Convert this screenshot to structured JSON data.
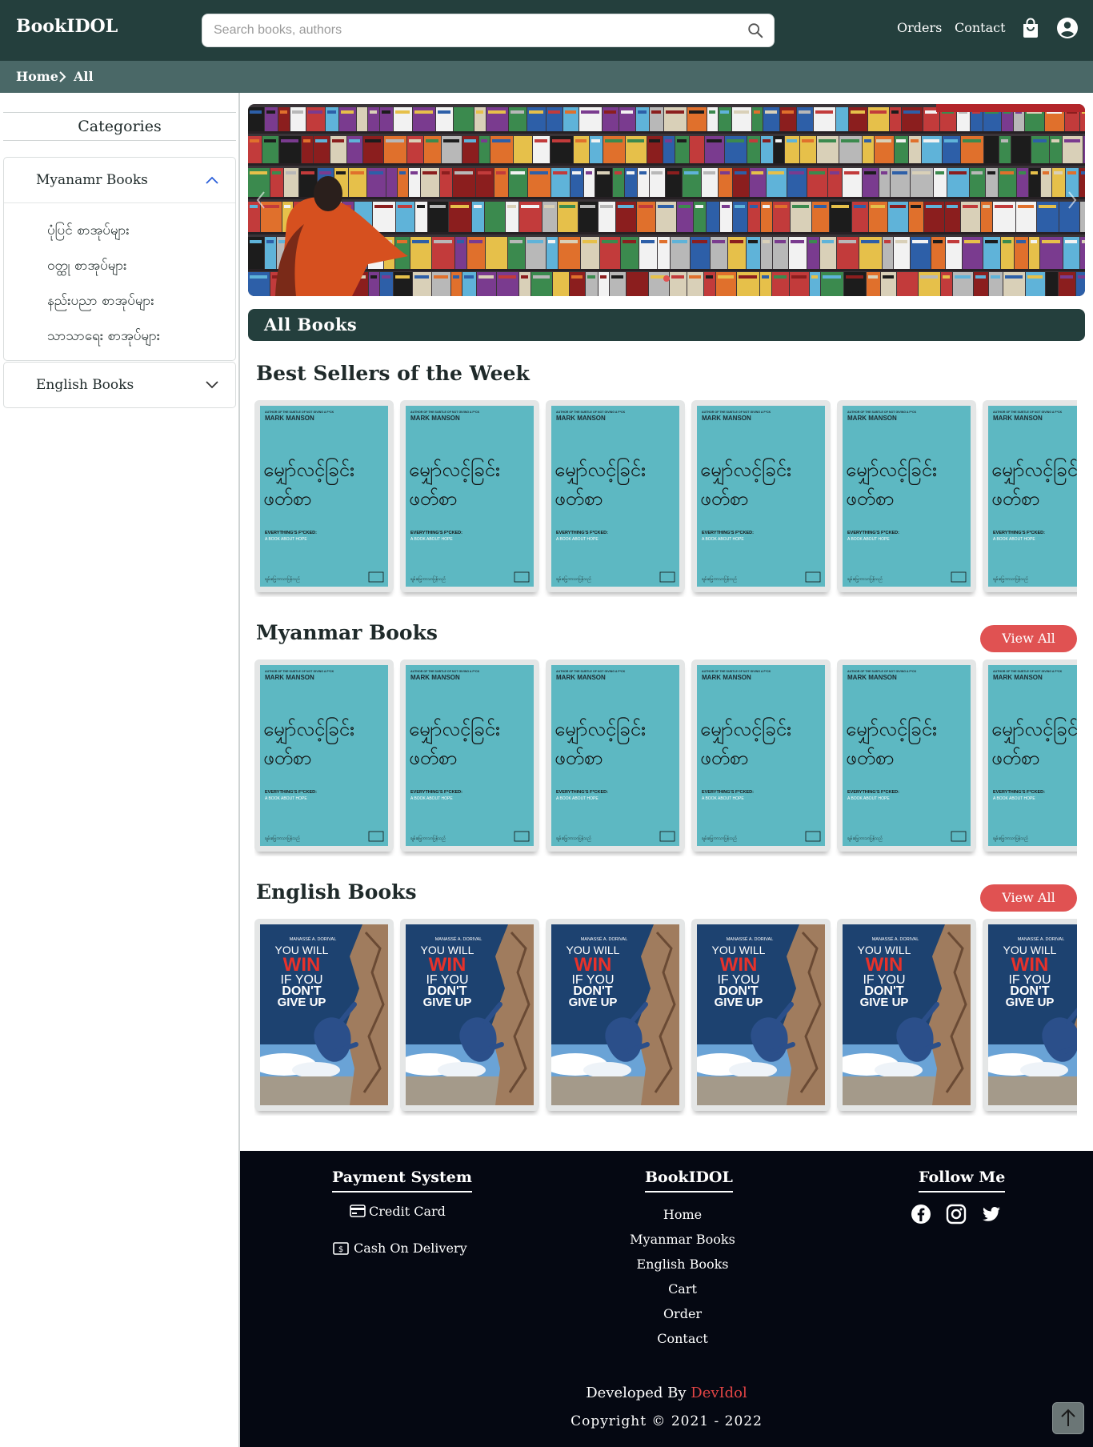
{
  "header": {
    "brand": "BookIDOL",
    "search_placeholder": "Search books, authors",
    "nav": [
      "Orders",
      "Contact"
    ]
  },
  "breadcrumb": {
    "home": "Home",
    "current": "All"
  },
  "sidebar": {
    "title": "Categories",
    "groups": [
      {
        "label": "Myanamr Books",
        "expanded": true,
        "items": [
          "ပုံပြင် စာအုပ်များ",
          "ဝတ္ထု စာအုပ်များ",
          "နည်းပညာ စာအုပ်များ",
          "သာသာရေး စာအုပ်များ"
        ]
      },
      {
        "label": "English Books",
        "expanded": false,
        "items": []
      }
    ]
  },
  "main": {
    "all_books_label": "All Books",
    "sections": [
      {
        "title": "Best Sellers of the Week",
        "view_all": "",
        "cover": "myanmar"
      },
      {
        "title": "Myanmar Books",
        "view_all": "View All",
        "cover": "myanmar"
      },
      {
        "title": "English Books",
        "view_all": "View All",
        "cover": "english"
      }
    ],
    "covers": {
      "myanmar": {
        "top_line": "AUTHOR OF THE SUBTLE OF NOT GIVING A F*CK",
        "author": "MARK MANSON",
        "title_line1": "မျှော်လင့်ခြင်း",
        "title_line2": "ဖတ်စာ",
        "sub1": "EVERYTHING'S F*CKED:",
        "sub2": "A BOOK ABOUT HOPE",
        "bottom": "ချမ်းမြေ့ဘာသာပြန်သည်",
        "color": "#5db8c2"
      },
      "english": {
        "author": "MANASSÉ A. DORIVAL",
        "line1": "YOU WILL",
        "line2": "WIN",
        "line3": "IF YOU",
        "line4": "DON'T",
        "line5": "GIVE UP",
        "accent": "#e8322b"
      }
    }
  },
  "footer": {
    "payment_title": "Payment System",
    "payments": [
      "Credit Card",
      "Cash On Delivery"
    ],
    "brand_title": "BookIDOL",
    "links": [
      "Home",
      "Myanmar Books",
      "English Books",
      "Cart",
      "Order",
      "Contact"
    ],
    "follow_title": "Follow Me",
    "developed_by": "Developed By",
    "developer": "DevIdol",
    "copyright": "Copyright © 2021 - 2022"
  }
}
